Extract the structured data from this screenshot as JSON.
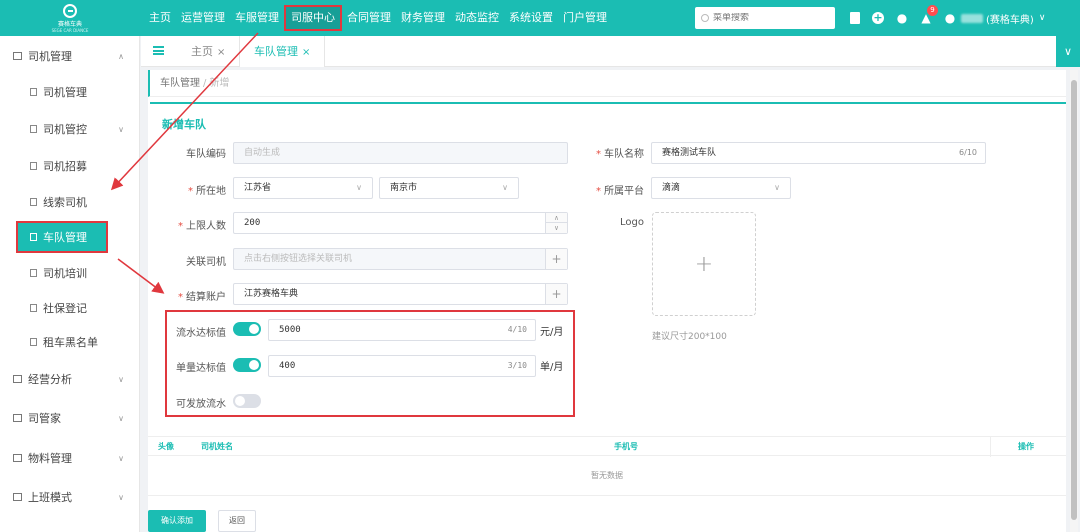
{
  "app": {
    "logo_text": "赛格车典",
    "logo_sub": "SEGE CAR DIANCE"
  },
  "top_nav": {
    "items": [
      "主页",
      "运营管理",
      "车服管理",
      "司服中心",
      "合同管理",
      "财务管理",
      "动态监控",
      "系统设置",
      "门户管理"
    ],
    "active_index": 3
  },
  "search": {
    "placeholder": "菜单搜索"
  },
  "notifications": {
    "badge": "9"
  },
  "user": {
    "company": "(赛格车典)"
  },
  "sidebar": {
    "items": [
      {
        "label": "司机管理",
        "level": "top",
        "expanded": true
      },
      {
        "label": "司机管理",
        "level": "sub"
      },
      {
        "label": "司机管控",
        "level": "sub",
        "has_children": true
      },
      {
        "label": "司机招募",
        "level": "sub"
      },
      {
        "label": "线索司机",
        "level": "sub"
      },
      {
        "label": "车队管理",
        "level": "sub",
        "active": true
      },
      {
        "label": "司机培训",
        "level": "sub"
      },
      {
        "label": "社保登记",
        "level": "sub"
      },
      {
        "label": "租车黑名单",
        "level": "sub"
      },
      {
        "label": "经营分析",
        "level": "top"
      },
      {
        "label": "司管家",
        "level": "top"
      },
      {
        "label": "物料管理",
        "level": "top"
      },
      {
        "label": "上班模式",
        "level": "top"
      }
    ]
  },
  "tabs": [
    {
      "label": "主页",
      "close": "×"
    },
    {
      "label": "车队管理",
      "close": "×",
      "active": true
    }
  ],
  "breadcrumb": {
    "parent": "车队管理",
    "separator": "/",
    "current": "新增"
  },
  "form": {
    "title": "新增车队",
    "fleet_code": {
      "label": "车队编码",
      "placeholder": "自动生成"
    },
    "fleet_name": {
      "label": "车队名称",
      "value": "赛格测试车队",
      "count": "6/10"
    },
    "location": {
      "label": "所在地",
      "province": "江苏省",
      "city": "南京市"
    },
    "platform": {
      "label": "所属平台",
      "value": "滴滴"
    },
    "max_people": {
      "label": "上限人数",
      "value": "200"
    },
    "logo": {
      "label": "Logo",
      "hint": "建议尺寸200*100"
    },
    "linked_drivers": {
      "label": "关联司机",
      "placeholder": "点击右侧按钮选择关联司机"
    },
    "settlement_account": {
      "label": "结算账户",
      "value": "江苏赛格车典"
    },
    "flow_target": {
      "label": "流水达标值",
      "value": "5000",
      "count": "4/10",
      "unit": "元/月",
      "enabled": true
    },
    "order_target": {
      "label": "单量达标值",
      "value": "400",
      "count": "3/10",
      "unit": "单/月",
      "enabled": true
    },
    "release_flow": {
      "label": "可发放流水",
      "enabled": false
    }
  },
  "table": {
    "columns": [
      "头像",
      "司机姓名",
      "手机号",
      "操作"
    ],
    "empty_text": "暂无数据"
  },
  "buttons": {
    "confirm": "确认添加",
    "back": "返回"
  },
  "colors": {
    "brand": "#1bbdb3",
    "annotation_red": "#e0383e"
  }
}
